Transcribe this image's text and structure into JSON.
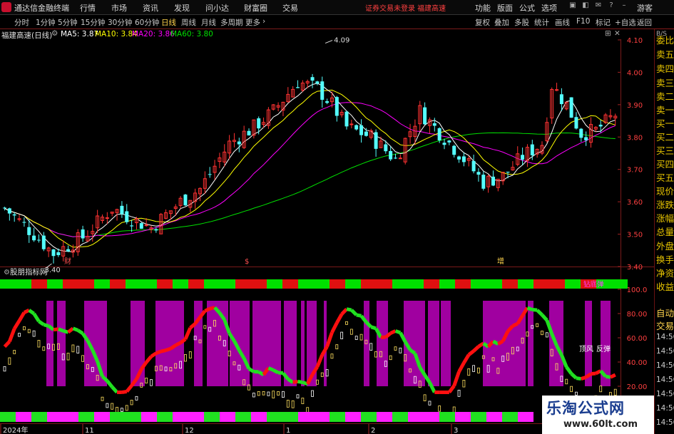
{
  "app": {
    "name": "通达信金融终端",
    "login_status": "证券交易未登录 福建高速"
  },
  "menu": [
    "行情",
    "市场",
    "资讯",
    "发现",
    "问小达",
    "财富圈",
    "交易"
  ],
  "right_menu": [
    "功能",
    "版面",
    "公式",
    "选项",
    "游客"
  ],
  "timeframes": [
    "分时",
    "1分钟",
    "5分钟",
    "15分钟",
    "30分钟",
    "60分钟",
    "日线",
    "周线",
    "月线",
    "多周期",
    "更多"
  ],
  "active_timeframe": "日线",
  "toolbar_right": [
    "复权",
    "叠加",
    "多股",
    "统计",
    "画线",
    "F10",
    "标记",
    "+自选",
    "返回"
  ],
  "stock": {
    "title": "福建高速(日线)"
  },
  "ma": [
    {
      "label": "MA5: 3.87",
      "color": "#ffffff"
    },
    {
      "label": "MA10: 3.84",
      "color": "#ffff00"
    },
    {
      "label": "MA20: 3.86",
      "color": "#ff00ff"
    },
    {
      "label": "MA60: 3.80",
      "color": "#00e000"
    }
  ],
  "price_axis": [
    "4.10",
    "4.00",
    "3.90",
    "3.80",
    "3.70",
    "3.60",
    "3.50",
    "3.40"
  ],
  "annotations": {
    "high": "4.09",
    "low": "3.40"
  },
  "event_markers": [
    "财",
    "$",
    "增"
  ],
  "indicator": {
    "name": "股朋指标网",
    "tag": "钻底弹",
    "labels": [
      "顶风",
      "反弹"
    ]
  },
  "indicator_axis": [
    "100.0",
    "80.00",
    "60.00",
    "40.00",
    "20.00"
  ],
  "date_axis": [
    "2024年",
    "11",
    "12",
    "1",
    "2",
    "3"
  ],
  "side_items": [
    "委比",
    "卖五",
    "卖四",
    "卖三",
    "卖二",
    "卖一",
    "买一",
    "买二",
    "买三",
    "买四",
    "买五",
    "现价",
    "涨跌",
    "涨幅",
    "总量",
    "外盘",
    "换手",
    "净资",
    "收益",
    "自动",
    "交易"
  ],
  "side_times": [
    "14:56",
    "14:56",
    "14:56",
    "14:56",
    "14:56",
    "14:56",
    "14:56"
  ],
  "watermark": {
    "title": "乐淘公式网",
    "url": "www.60lt.com"
  },
  "colors": {
    "up": "#ff3232",
    "down": "#54ffff",
    "ma5": "#ffffff",
    "ma10": "#ffff00",
    "ma20": "#ff00ff",
    "ma60": "#00e000",
    "band": "#a000a0",
    "accent_red": "#c8102e"
  }
}
